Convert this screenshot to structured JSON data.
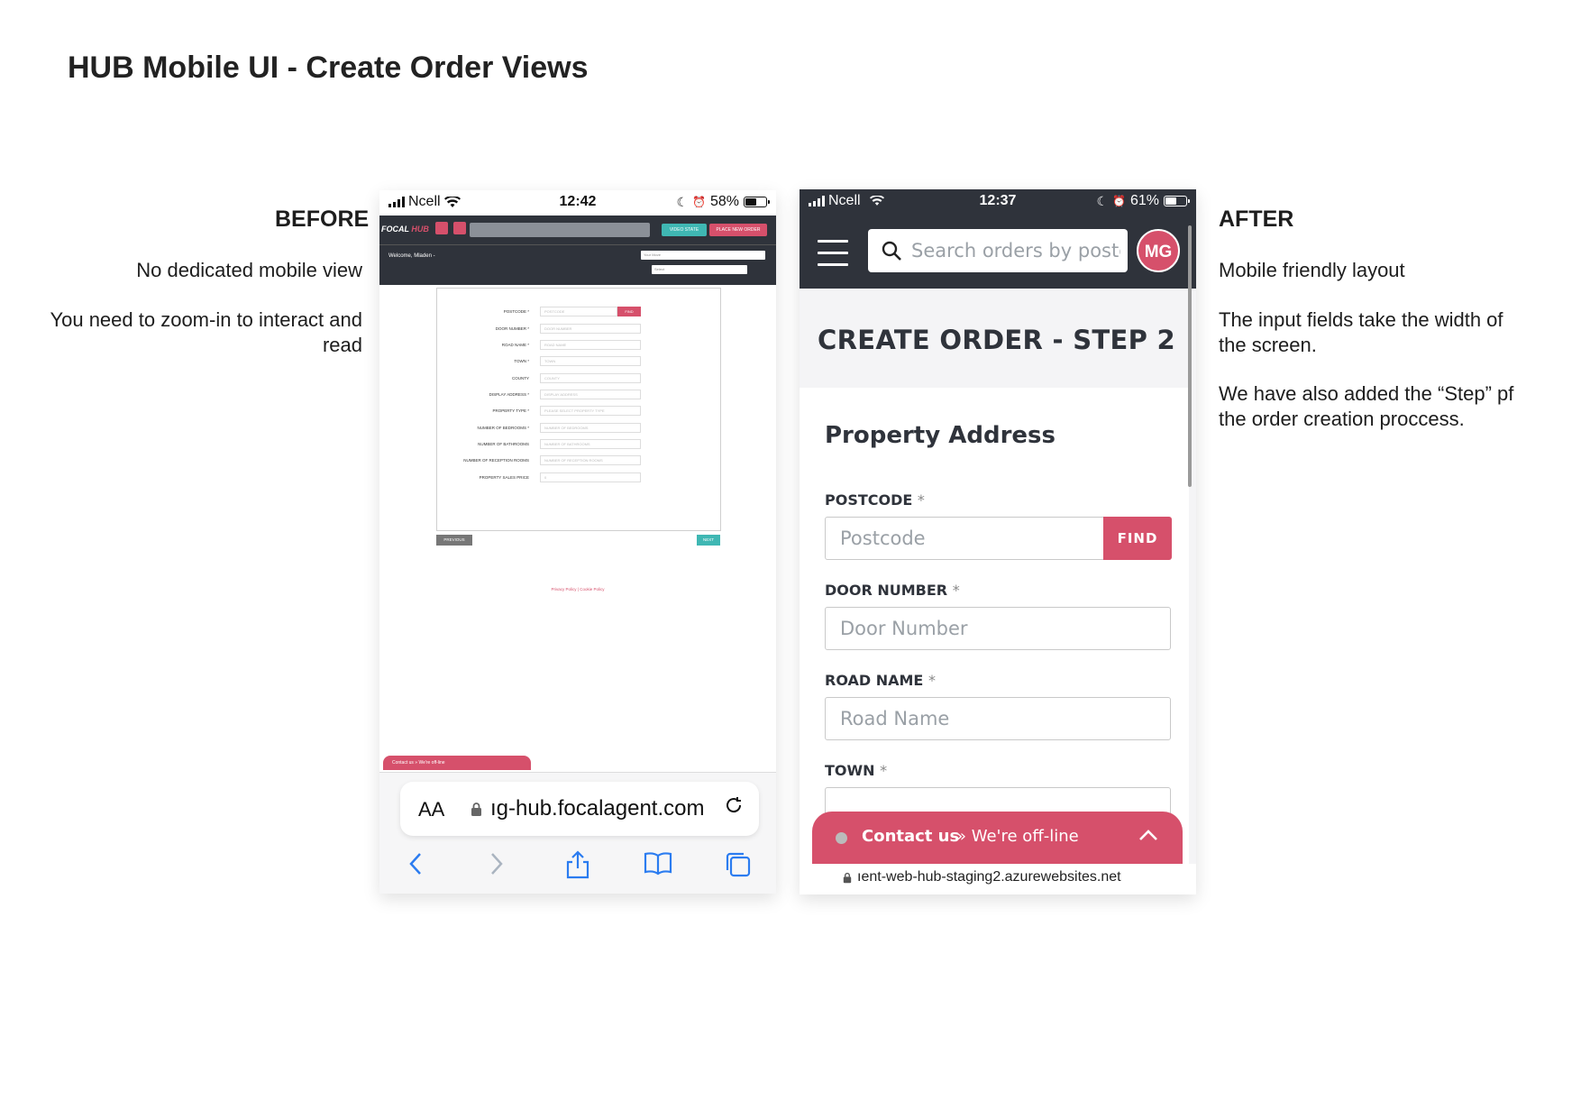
{
  "page": {
    "title": "HUB Mobile UI - Create Order Views"
  },
  "before_notes": {
    "heading": "BEFORE",
    "note1": "No dedicated mobile view",
    "note2a": "You need to zoom-in to interact and",
    "note2b": "read"
  },
  "after_notes": {
    "heading": "AFTER",
    "note1": "Mobile friendly layout",
    "note2a": "The input fields take the width of",
    "note2b": "the screen.",
    "note3a": "We have also added the “Step” pf",
    "note3b": "the order creation proccess."
  },
  "before_phone": {
    "status": {
      "carrier": "Ncell",
      "time": "12:42",
      "battery": "58%",
      "battery_level": 0.58
    },
    "app": {
      "logo_a": "FOCAL",
      "logo_b": "HUB",
      "video_state": "VIDEO STATE",
      "place_new_order": "PLACE NEW ORDER",
      "welcome": "Welcome, Mladen -",
      "select1": "Your Move",
      "select2": "Select"
    },
    "form": {
      "fields": [
        {
          "label": "POSTCODE *",
          "placeholder": "POSTCODE"
        },
        {
          "label": "DOOR NUMBER *",
          "placeholder": "DOOR NUMBER"
        },
        {
          "label": "ROAD NAME *",
          "placeholder": "ROAD NAME"
        },
        {
          "label": "TOWN *",
          "placeholder": "TOWN"
        },
        {
          "label": "COUNTY",
          "placeholder": "COUNTY"
        },
        {
          "label": "DISPLAY ADDRESS *",
          "placeholder": "DISPLAY ADDRESS"
        },
        {
          "label": "PROPERTY TYPE *",
          "placeholder": "PLEASE SELECT PROPERTY TYPE"
        },
        {
          "label": "NUMBER OF BEDROOMS *",
          "placeholder": "NUMBER OF BEDROOMS"
        },
        {
          "label": "NUMBER OF BATHROOMS",
          "placeholder": "NUMBER OF BATHROOMS"
        },
        {
          "label": "NUMBER OF RECEPTION ROOMS",
          "placeholder": "NUMBER OF RECEPTION ROOMS"
        },
        {
          "label": "PROPERTY SALES PRICE",
          "placeholder": "0"
        }
      ],
      "find": "FIND",
      "previous": "PREVIOUS",
      "next": "NEXT",
      "footer": "Privacy Policy | Cookie Policy",
      "contact": "Contact us » We're off-line"
    },
    "safari": {
      "aa": "AA",
      "url": "ıg-hub.focalagent.com"
    }
  },
  "after_phone": {
    "status": {
      "carrier": "Ncell",
      "time": "12:37",
      "battery": "61%",
      "battery_level": 0.61
    },
    "search_placeholder": "Search orders by postcode",
    "avatar": "MG",
    "page_title": "CREATE ORDER - STEP 2",
    "section_title": "Property Address",
    "fields": [
      {
        "label": "POSTCODE",
        "required": "*",
        "placeholder": "Postcode"
      },
      {
        "label": "DOOR NUMBER",
        "required": "*",
        "placeholder": "Door Number"
      },
      {
        "label": "ROAD NAME",
        "required": "*",
        "placeholder": "Road Name"
      },
      {
        "label": "TOWN",
        "required": "*",
        "placeholder": ""
      }
    ],
    "find": "FIND",
    "contact_us": "Contact us",
    "offline": "» We're off-line",
    "url": "ıent-web-hub-staging2.azurewebsites.net"
  },
  "colors": {
    "brand_pink": "#d6506b",
    "dark_header": "#2f333b",
    "teal": "#3fb7b3",
    "ios_blue": "#2b7cf0"
  }
}
